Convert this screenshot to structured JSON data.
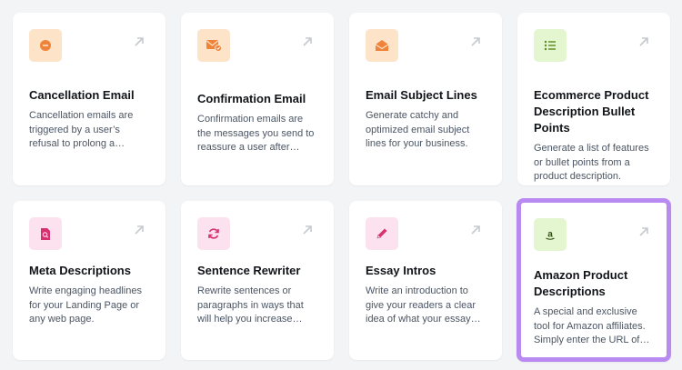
{
  "cards": [
    {
      "title": "Cancellation Email",
      "description": "Cancellation emails are triggered by a user’s refusal to prolong a…",
      "icon": "cancel-circle-icon",
      "accent": "#f0833a"
    },
    {
      "title": "Confirmation Email",
      "description": "Confirmation emails are the messages you send to reassure a user after…",
      "icon": "mail-check-icon",
      "accent": "#f0833a"
    },
    {
      "title": "Email Subject Lines",
      "description": "Generate catchy and optimized email subject lines for your business.",
      "icon": "open-envelope-icon",
      "accent": "#f0833a"
    },
    {
      "title": "Ecommerce Product Description Bullet Points",
      "description": "Generate a list of features or bullet points from a product description.",
      "icon": "bullet-list-icon",
      "accent": "#5a8a1e"
    },
    {
      "title": "Meta Descriptions",
      "description": "Write engaging headlines for your Landing Page or any web page.",
      "icon": "document-search-icon",
      "accent": "#d6306f"
    },
    {
      "title": "Sentence Rewriter",
      "description": "Rewrite sentences or paragraphs in ways that will help you increase…",
      "icon": "refresh-icon",
      "accent": "#d6306f"
    },
    {
      "title": "Essay Intros",
      "description": "Write an introduction to give your readers a clear idea of what your essay…",
      "icon": "pencil-icon",
      "accent": "#d6306f"
    },
    {
      "title": "Amazon Product Descriptions",
      "description": "A special and exclusive tool for Amazon affiliates. Simply enter the URL of…",
      "icon": "amazon-icon",
      "accent": "#2f4f10",
      "selected": true
    }
  ],
  "colors": {
    "selected_border": "#b98af2",
    "arrow": "#c5c9cf"
  }
}
